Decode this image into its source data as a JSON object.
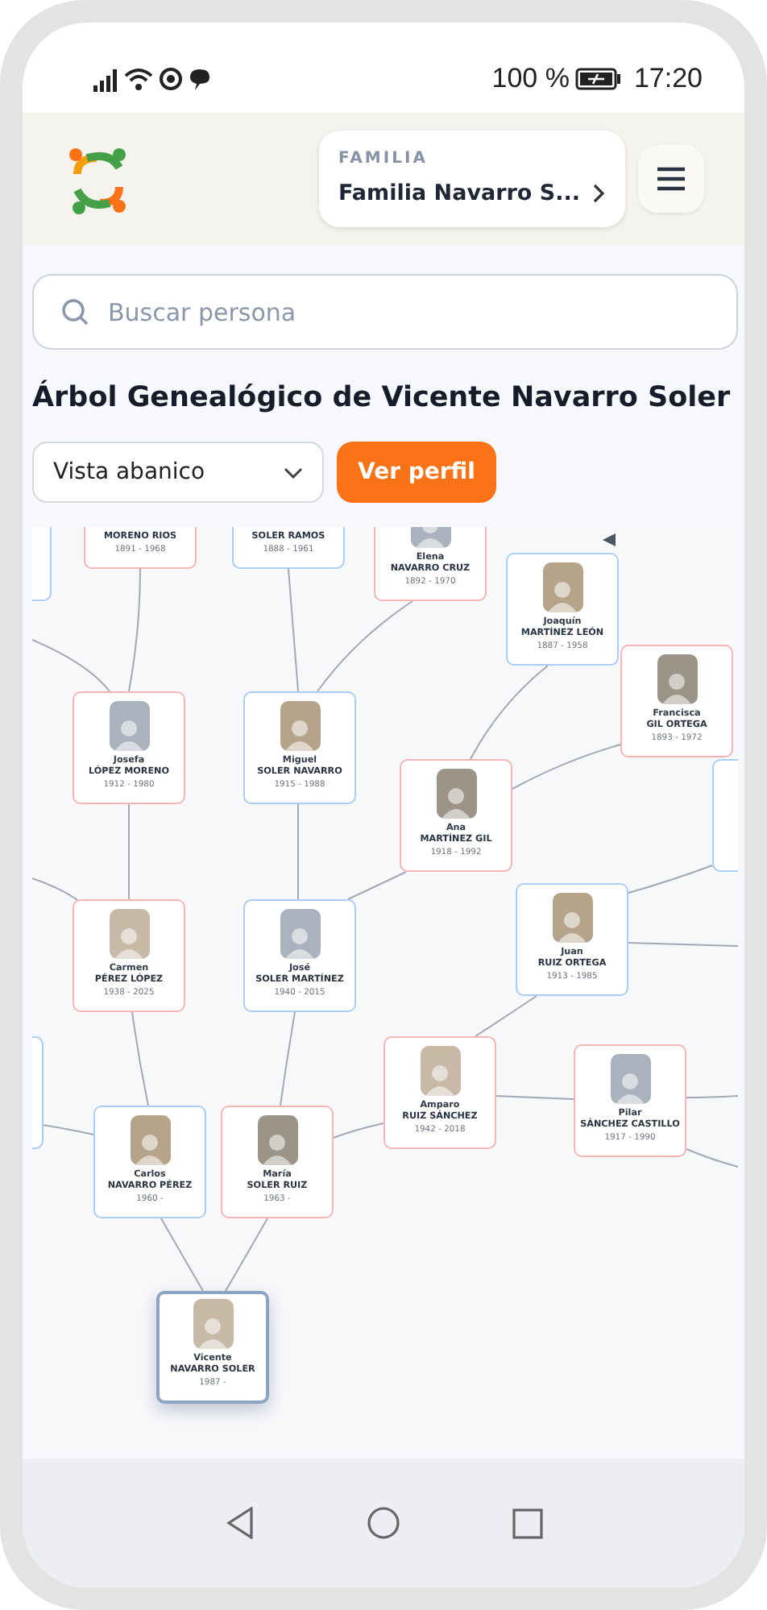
{
  "status_bar": {
    "battery": "100 %",
    "time": "17:20"
  },
  "header": {
    "family_selector": {
      "label": "FAMILIA",
      "value": "Familia Navarro S..."
    }
  },
  "search": {
    "placeholder": "Buscar persona"
  },
  "title": "Árbol Genealógico de Vicente Navarro Soler",
  "view_select": {
    "value": "Vista abanico"
  },
  "profile_button": "Ver perfil",
  "tree": {
    "nodes": [
      {
        "color": "#a9cdf5",
        "selected": false
      },
      {
        "surname": "MORENO RIOS",
        "dates": "1891 - 1968",
        "color": "#f8b4b4",
        "selected": false
      },
      {
        "surname": "SOLER RAMOS",
        "dates": "1888 - 1961",
        "color": "#a9cdf5",
        "selected": false
      },
      {
        "first_name": "Elena",
        "surname": "NAVARRO CRUZ",
        "dates": "1892 - 1970",
        "color": "#f8b4b4",
        "selected": false
      },
      {
        "first_name": "Joaquín",
        "surname": "MARTÍNEZ LEÓN",
        "dates": "1887 - 1958",
        "color": "#a9cdf5",
        "selected": false
      },
      {
        "first_name": "Francisca",
        "surname": "GIL ORTEGA",
        "dates": "1893 - 1972",
        "color": "#f8b4b4",
        "selected": false
      },
      {
        "color": "#a9cdf5",
        "selected": false
      },
      {
        "first_name": "Josefa",
        "surname": "LÓPEZ MORENO",
        "dates": "1912 - 1980",
        "color": "#f8b4b4",
        "selected": false
      },
      {
        "first_name": "Miguel",
        "surname": "SOLER NAVARRO",
        "dates": "1915 - 1988",
        "color": "#a9cdf5",
        "selected": false
      },
      {
        "first_name": "Ana",
        "surname": "MARTÍNEZ GIL",
        "dates": "1918 - 1992",
        "color": "#f8b4b4",
        "selected": false
      },
      {
        "first_name": "Carmen",
        "surname": "PÉREZ LÓPEZ",
        "dates": "1938 - 2025",
        "color": "#f8b4b4",
        "selected": false
      },
      {
        "first_name": "José",
        "surname": "SOLER MARTÍNEZ",
        "dates": "1940 - 2015",
        "color": "#a9cdf5",
        "selected": false
      },
      {
        "first_name": "Juan",
        "surname": "RUIZ ORTEGA",
        "dates": "1913 - 1985",
        "color": "#a9cdf5",
        "selected": false
      },
      {
        "color": "#a9cdf5",
        "selected": false
      },
      {
        "first_name": "Amparo",
        "surname": "RUIZ SÁNCHEZ",
        "dates": "1942 - 2018",
        "color": "#f8b4b4",
        "selected": false
      },
      {
        "first_name": "Pilar",
        "surname": "SÁNCHEZ CASTILLO",
        "dates": "1917 - 1990",
        "color": "#f8b4b4",
        "selected": false
      },
      {
        "first_name": "Carlos",
        "surname": "NAVARRO PÉREZ",
        "dates": "1960 -",
        "color": "#a9cdf5",
        "selected": false
      },
      {
        "first_name": "María",
        "surname": "SOLER RUIZ",
        "dates": "1963 -",
        "color": "#f8b4b4",
        "selected": false
      },
      {
        "first_name": "Vicente",
        "surname": "NAVARRO SOLER",
        "dates": "1987 -",
        "color": "#8ba3c4",
        "selected": true
      }
    ]
  }
}
